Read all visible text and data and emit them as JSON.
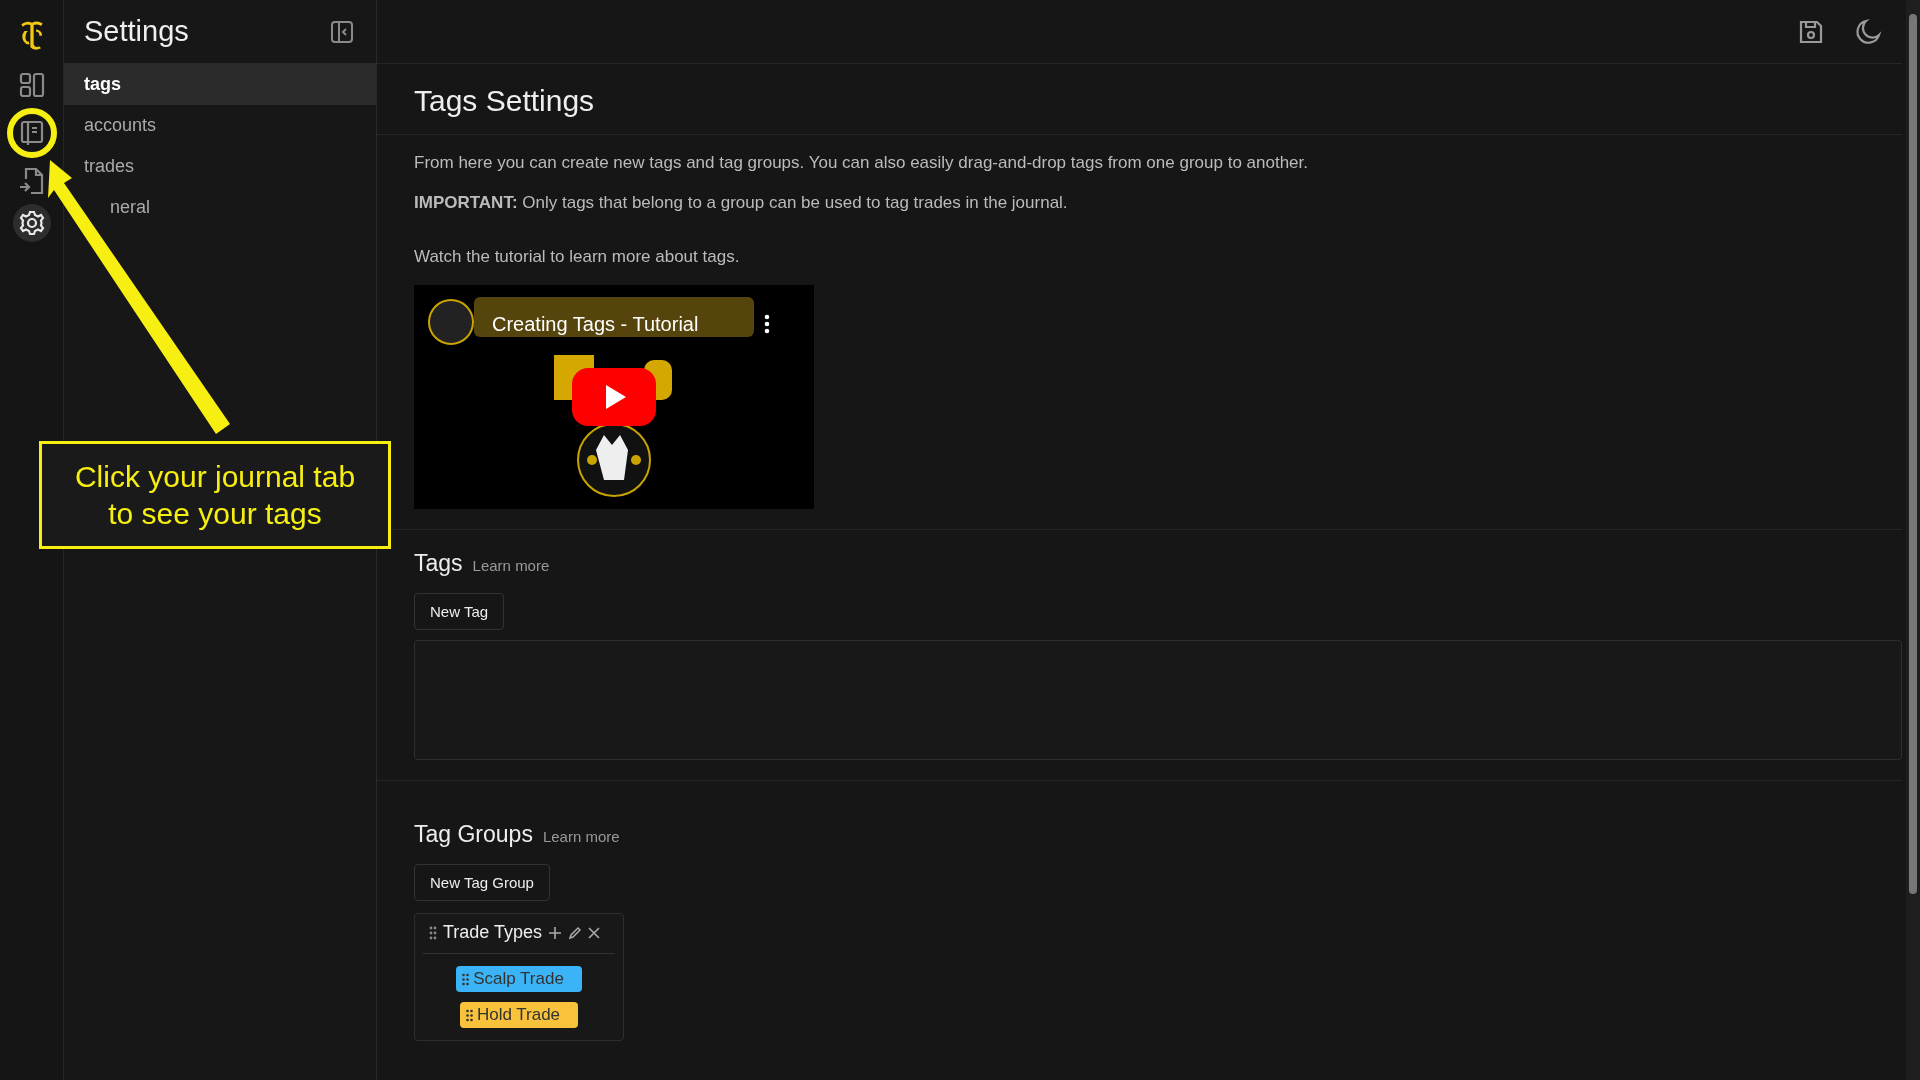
{
  "rail": [
    {
      "kind": "logo",
      "selected": false
    },
    {
      "kind": "dashboard",
      "selected": false
    },
    {
      "kind": "journal",
      "selected": false,
      "highlighted": true
    },
    {
      "kind": "import",
      "selected": false
    },
    {
      "kind": "settings",
      "selected": true
    }
  ],
  "sidebar": {
    "title": "Settings",
    "items": [
      {
        "label": "tags",
        "selected": true
      },
      {
        "label": "accounts",
        "selected": false
      },
      {
        "label": "trades",
        "selected": false
      },
      {
        "label": "neral",
        "selected": false
      }
    ]
  },
  "main": {
    "title": "Tags Settings",
    "intro": "From here you can create new tags and tag groups. You can also easily drag-and-drop tags from one group to another.",
    "important": "**IMPORTANT:** Only tags that belong to a group can be used to tag trades in the journal.",
    "watch": "Watch the tutorial to learn more about tags.",
    "video": {
      "title": "Creating Tags - Tutorial",
      "kind": "picture"
    },
    "tags": {
      "heading": "Tags",
      "learn_more": "Learn more",
      "button": "New Tag"
    },
    "tag_groups": {
      "heading": "Tag Groups",
      "learn_more": "Learn more",
      "button": "New Tag Group",
      "groups": [
        {
          "name": "Trade Types",
          "tags": [
            {
              "label": "Scalp Trade",
              "color": "#3bb4f7"
            },
            {
              "label": "Hold Trade",
              "color": "#f8c23a"
            }
          ]
        }
      ]
    }
  },
  "annotation": {
    "text": "Click your journal tab to see your tags"
  }
}
